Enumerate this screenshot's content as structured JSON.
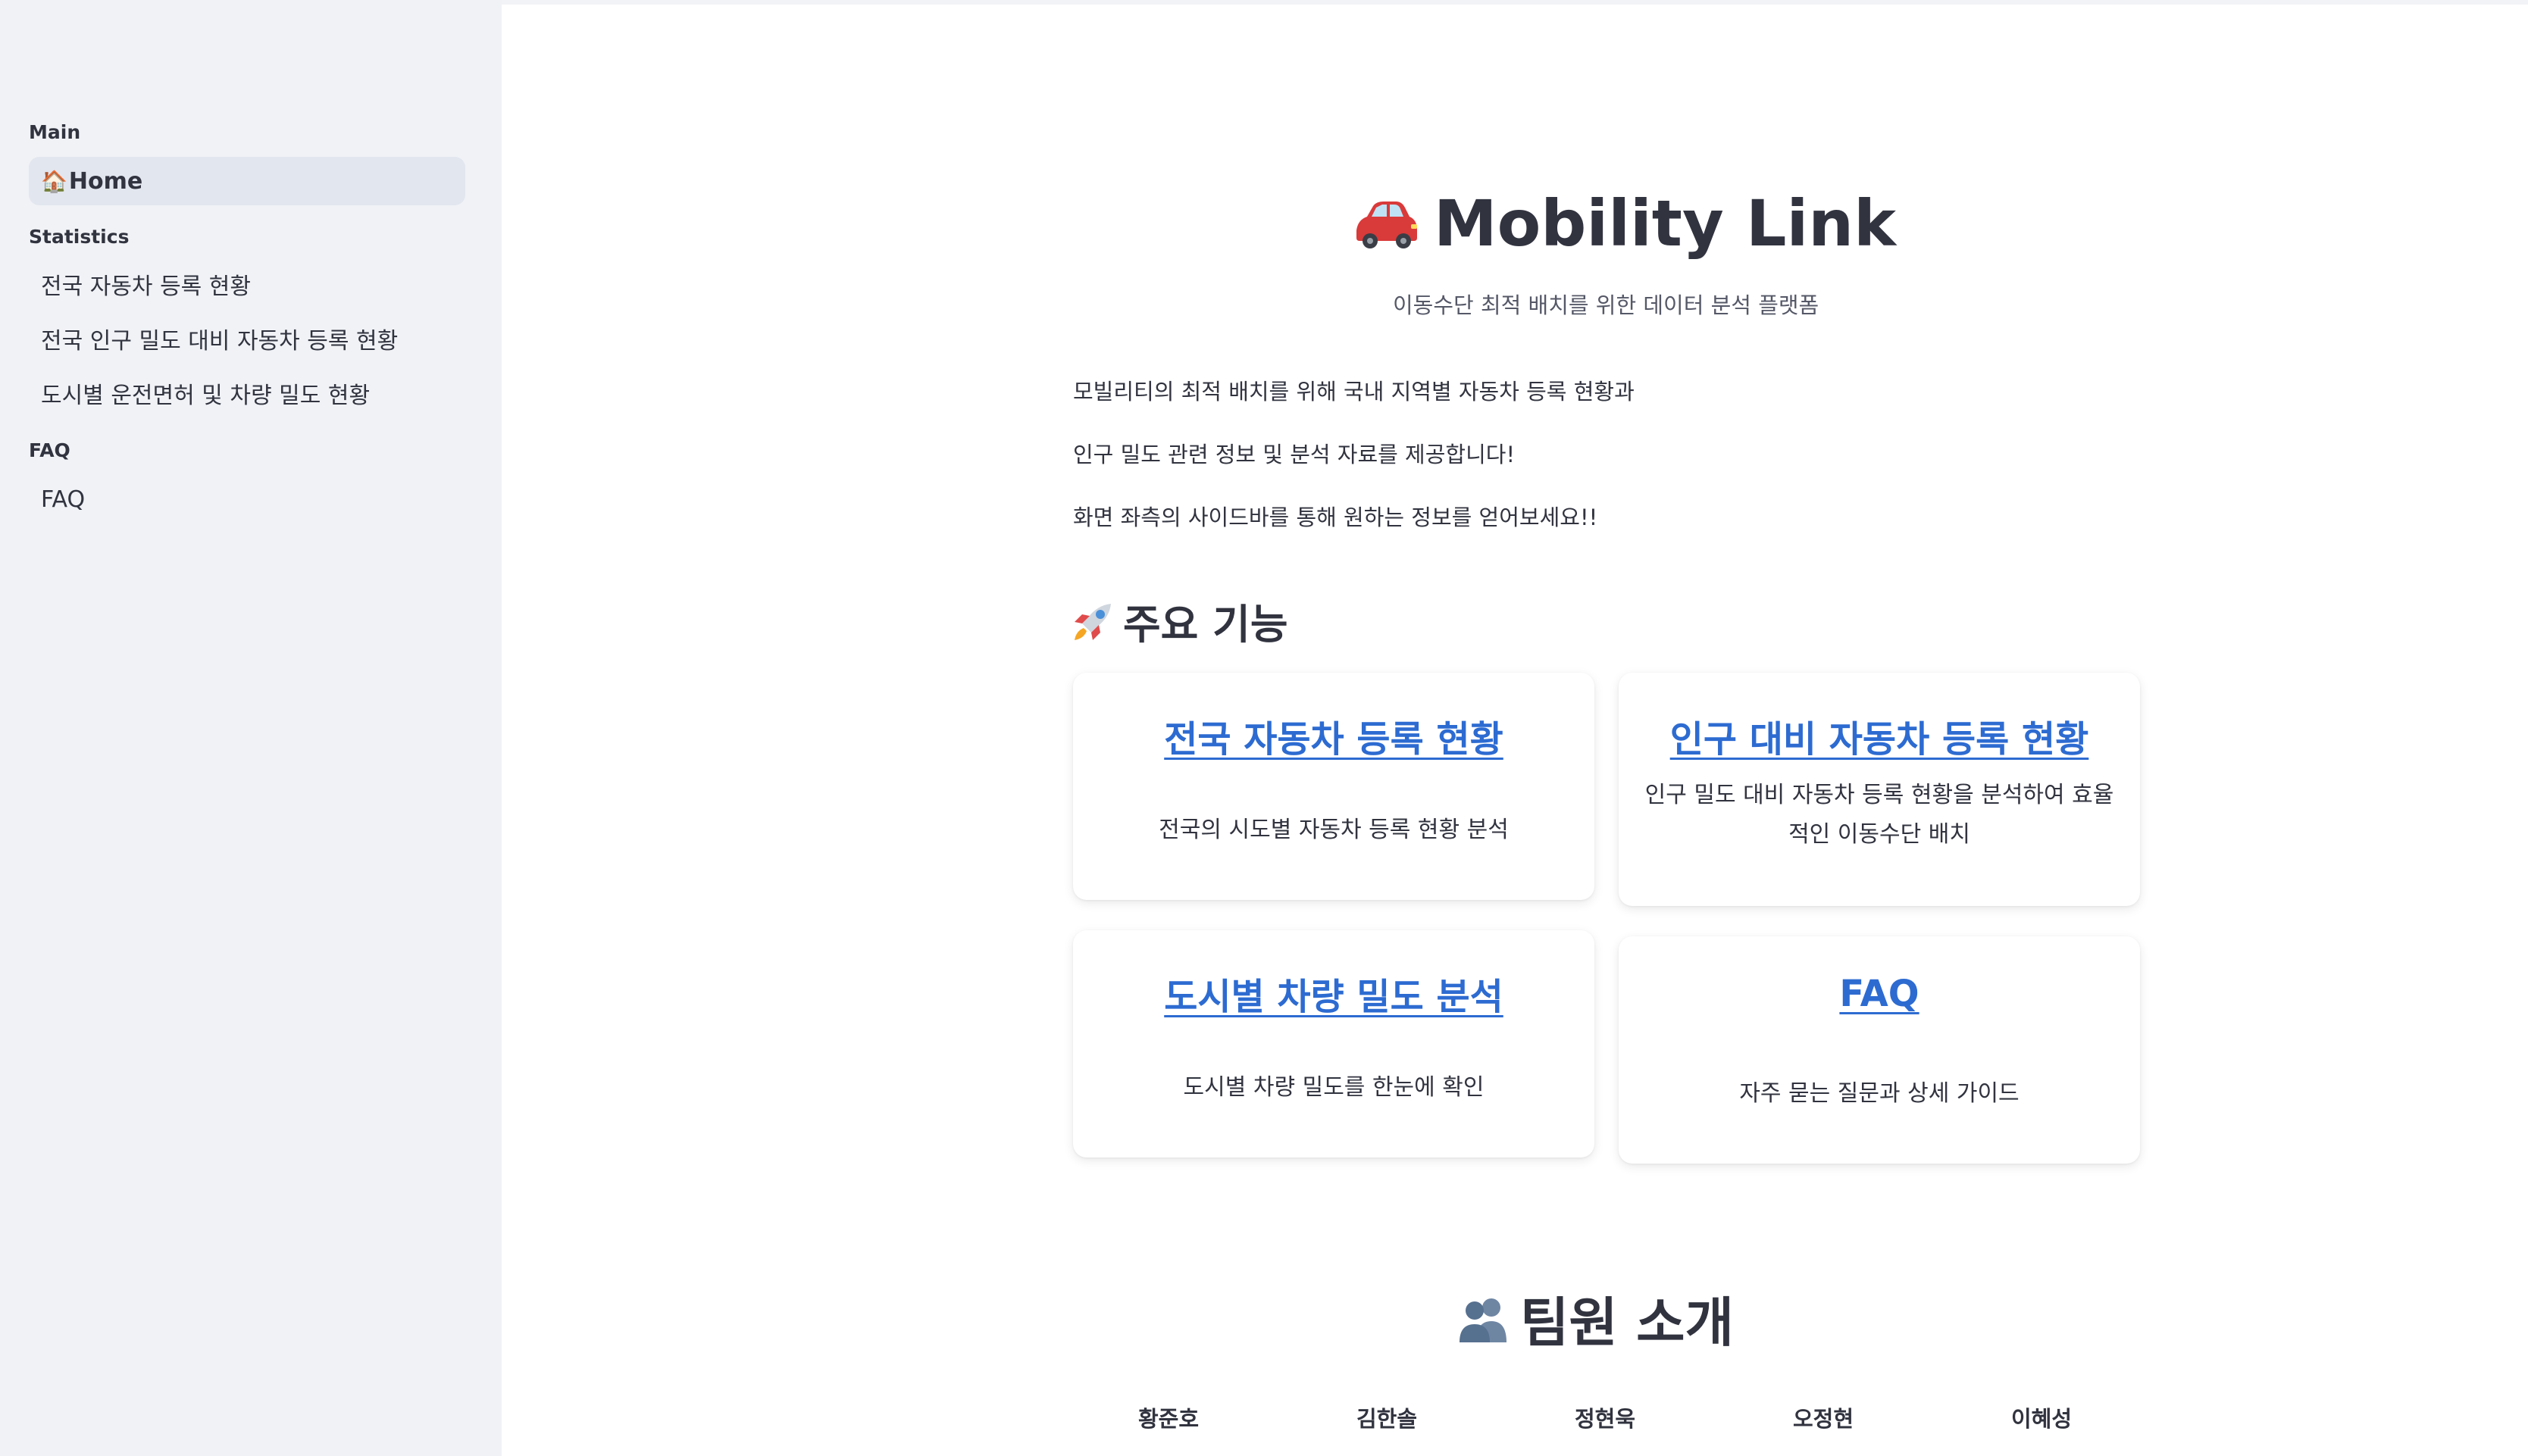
{
  "sidebar": {
    "sections": [
      {
        "label": "Main"
      },
      {
        "label": "Statistics"
      },
      {
        "label": "FAQ"
      }
    ],
    "items": [
      {
        "emoji": "🏠",
        "label": "Home",
        "active": true
      },
      {
        "label": "전국 자동차 등록 현황"
      },
      {
        "label": "전국 인구 밀도 대비 자동차 등록 현황"
      },
      {
        "label": "도시별 운전면허 및 차량 밀도 현황"
      },
      {
        "label": "FAQ"
      }
    ]
  },
  "main": {
    "title": "Mobility Link",
    "title_icon": "car-icon",
    "subtitle": "이동수단 최적 배치를 위한 데이터 분석 플랫폼",
    "intro": [
      "모빌리티의 최적 배치를 위해 국내 지역별 자동차 등록 현황과",
      "인구 밀도 관련 정보 및 분석 자료를 제공합니다!",
      "화면 좌측의 사이드바를 통해 원하는 정보를 얻어보세요!!"
    ],
    "features_heading": "주요 기능",
    "features_icon": "rocket-icon",
    "cards": [
      {
        "title": "전국 자동차 등록 현황",
        "desc": "전국의 시도별 자동차 등록 현황 분석"
      },
      {
        "title": "인구 대비 자동차 등록 현황",
        "desc": "인구 밀도 대비 자동차 등록 현황을 분석하여 효율적인 이동수단 배치"
      },
      {
        "title": "도시별 차량 밀도 분석",
        "desc": "도시별 차량 밀도를 한눈에 확인"
      },
      {
        "title": "FAQ",
        "desc": "자주 묻는 질문과 상세 가이드"
      }
    ],
    "team_heading": "팀원 소개",
    "team_icon": "people-icon",
    "members": [
      "황준호",
      "김한솔",
      "정현욱",
      "오정현",
      "이혜성"
    ]
  },
  "colors": {
    "sidebar_bg": "#f0f2f6",
    "active_item_bg": "#e2e6ee",
    "link": "#2d6bd1",
    "text": "#31333f"
  }
}
